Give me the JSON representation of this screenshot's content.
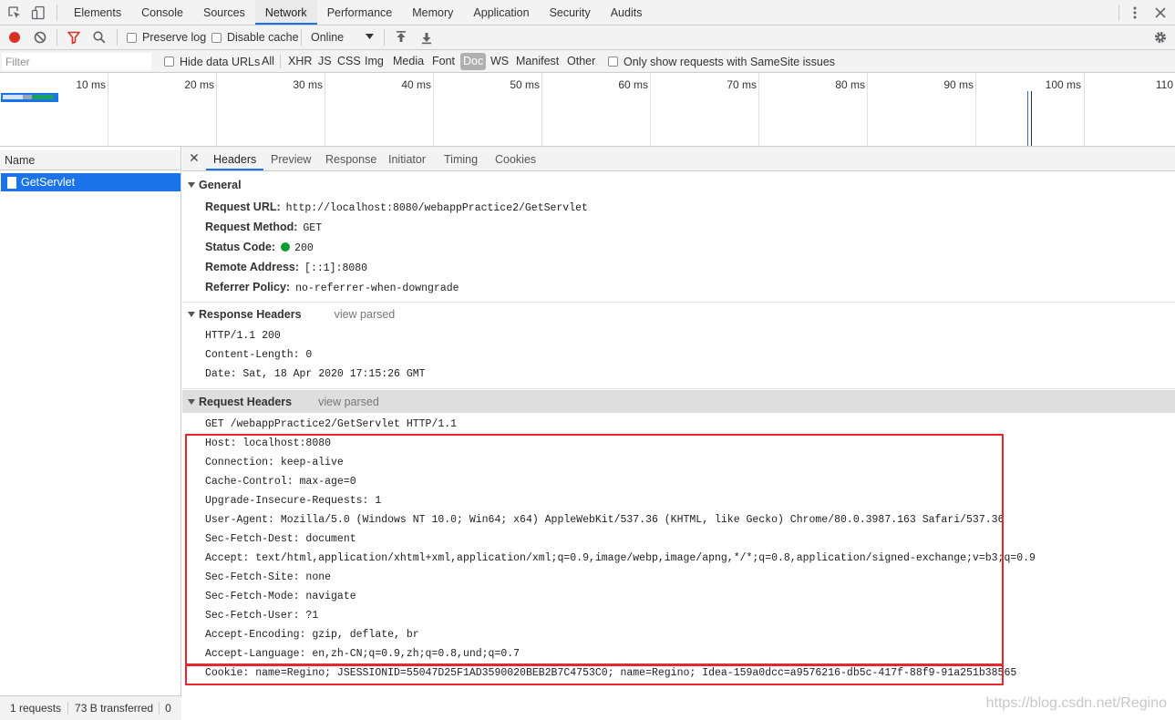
{
  "panel_tabs": [
    "Elements",
    "Console",
    "Sources",
    "Network",
    "Performance",
    "Memory",
    "Application",
    "Security",
    "Audits"
  ],
  "active_panel_tab": "Network",
  "toolbar": {
    "preserve_log": "Preserve log",
    "disable_cache": "Disable cache",
    "throttle": "Online"
  },
  "filterbar": {
    "placeholder": "Filter",
    "hide_data_urls": "Hide data URLs",
    "types": [
      "All",
      "XHR",
      "JS",
      "CSS",
      "Img",
      "Media",
      "Font",
      "Doc",
      "WS",
      "Manifest",
      "Other"
    ],
    "active_type": "Doc",
    "samesite": "Only show requests with SameSite issues"
  },
  "overview": {
    "ticks": [
      "10 ms",
      "20 ms",
      "30 ms",
      "40 ms",
      "50 ms",
      "60 ms",
      "70 ms",
      "80 ms",
      "90 ms",
      "100 ms",
      "110"
    ]
  },
  "requests": {
    "column_name": "Name",
    "items": [
      "GetServlet"
    ]
  },
  "statusbar": {
    "requests": "1 requests",
    "transferred": "73 B transferred",
    "extra": "0"
  },
  "detail_tabs": [
    "Headers",
    "Preview",
    "Response",
    "Initiator",
    "Timing",
    "Cookies"
  ],
  "active_detail_tab": "Headers",
  "general": {
    "title": "General",
    "rows": [
      {
        "key": "Request URL:",
        "value": "http://localhost:8080/webappPractice2/GetServlet"
      },
      {
        "key": "Request Method:",
        "value": "GET"
      },
      {
        "key": "Status Code:",
        "value": "200"
      },
      {
        "key": "Remote Address:",
        "value": "[::1]:8080"
      },
      {
        "key": "Referrer Policy:",
        "value": "no-referrer-when-downgrade"
      }
    ]
  },
  "response_headers": {
    "title": "Response Headers",
    "view_parsed": "view parsed",
    "lines": [
      "HTTP/1.1 200",
      "Content-Length: 0",
      "Date: Sat, 18 Apr 2020 17:15:26 GMT"
    ]
  },
  "request_headers": {
    "title": "Request Headers",
    "view_parsed": "view parsed",
    "lines": [
      "GET /webappPractice2/GetServlet HTTP/1.1",
      "Host: localhost:8080",
      "Connection: keep-alive",
      "Cache-Control: max-age=0",
      "Upgrade-Insecure-Requests: 1",
      "User-Agent: Mozilla/5.0 (Windows NT 10.0; Win64; x64) AppleWebKit/537.36 (KHTML, like Gecko) Chrome/80.0.3987.163 Safari/537.36",
      "Sec-Fetch-Dest: document",
      "Accept: text/html,application/xhtml+xml,application/xml;q=0.9,image/webp,image/apng,*/*;q=0.8,application/signed-exchange;v=b3;q=0.9",
      "Sec-Fetch-Site: none",
      "Sec-Fetch-Mode: navigate",
      "Sec-Fetch-User: ?1",
      "Accept-Encoding: gzip, deflate, br",
      "Accept-Language: en,zh-CN;q=0.9,zh;q=0.8,und;q=0.7",
      "Cookie: name=Regino; JSESSIONID=55047D25F1AD3590020BEB2B7C4753C0; name=Regino; Idea-159a0dcc=a9576216-db5c-417f-88f9-91a251b38565"
    ]
  },
  "watermark": "https://blog.csdn.net/Regino",
  "colors": {
    "accent": "#1a73e8",
    "record": "#d93025",
    "status_ok": "#0a9e2f",
    "highlight_box": "#e8262e"
  }
}
